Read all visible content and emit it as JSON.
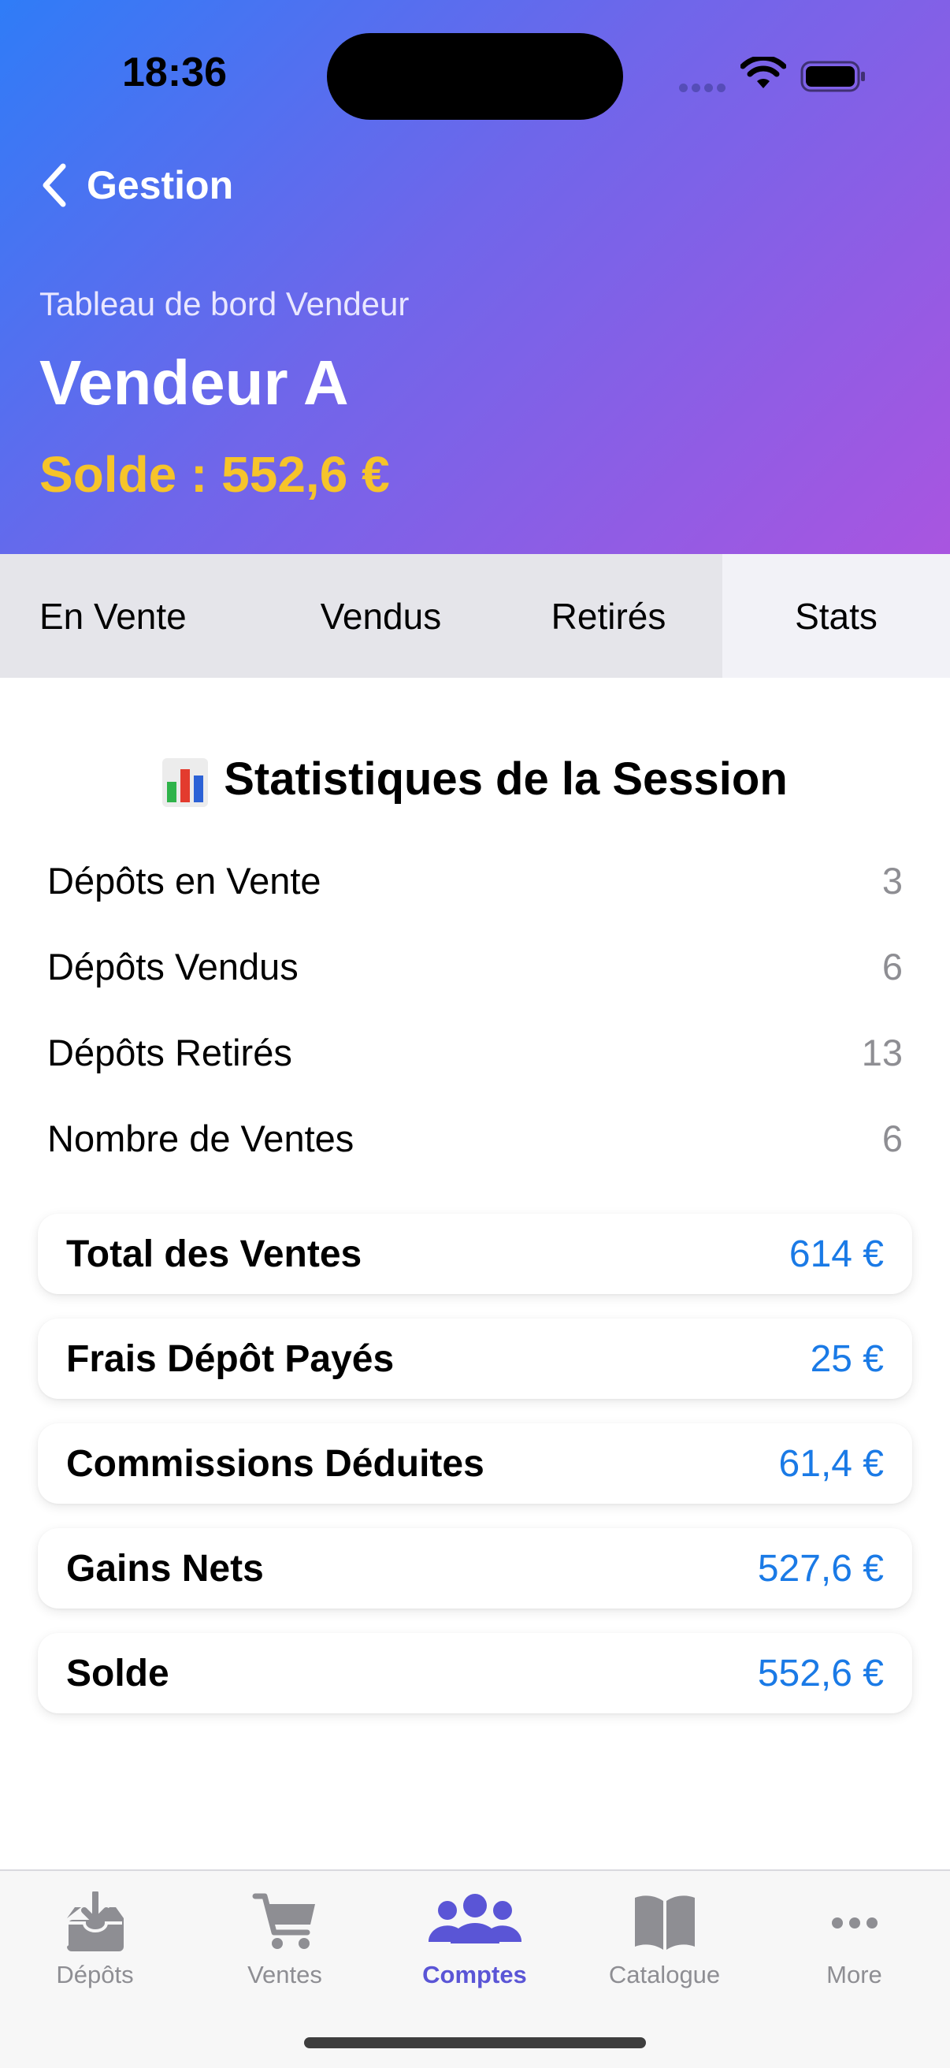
{
  "status": {
    "time": "18:36"
  },
  "nav": {
    "back_label": "Gestion"
  },
  "header": {
    "subtitle": "Tableau de bord Vendeur",
    "title": "Vendeur A",
    "balance": "Solde : 552,6 €"
  },
  "segments": [
    {
      "label": "En Vente"
    },
    {
      "label": "Vendus"
    },
    {
      "label": "Retirés"
    },
    {
      "label": "Stats",
      "selected": true
    }
  ],
  "stats": {
    "title": "Statistiques de la Session",
    "title_icon": "bar-chart-icon",
    "rows": [
      {
        "label": "Dépôts en Vente",
        "value": "3"
      },
      {
        "label": "Dépôts Vendus",
        "value": "6"
      },
      {
        "label": "Dépôts Retirés",
        "value": "13"
      },
      {
        "label": "Nombre de Ventes",
        "value": "6"
      }
    ],
    "cards": [
      {
        "label": "Total des Ventes",
        "value": "614 €"
      },
      {
        "label": "Frais Dépôt Payés",
        "value": "25 €"
      },
      {
        "label": "Commissions Déduites",
        "value": "61,4 €"
      },
      {
        "label": "Gains Nets",
        "value": "527,6 €"
      },
      {
        "label": "Solde",
        "value": "552,6 €"
      }
    ]
  },
  "tabbar": {
    "items": [
      {
        "label": "Dépôts",
        "icon": "tray-download-icon"
      },
      {
        "label": "Ventes",
        "icon": "cart-icon"
      },
      {
        "label": "Comptes",
        "icon": "people-icon",
        "active": true
      },
      {
        "label": "Catalogue",
        "icon": "book-icon"
      },
      {
        "label": "More",
        "icon": "more-icon"
      }
    ]
  },
  "colors": {
    "header_gradient_start": "#2f7cf7",
    "header_gradient_end": "#a955e0",
    "balance": "#f6c42a",
    "amount": "#1a7ae6",
    "active_tab": "#5a55d6"
  }
}
